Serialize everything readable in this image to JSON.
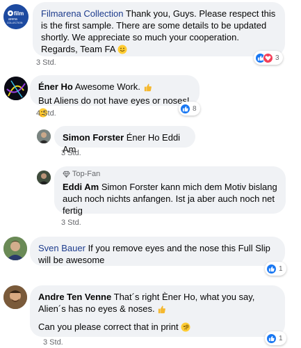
{
  "comments": [
    {
      "author": "Filmarena Collection",
      "text": "Thank you, Guys. Please respect this is the first sample. There are some details to be updated shortly. We appreciate so much your cooperation. Regards, Team FA",
      "time": "3 Std.",
      "reactions_count": "3"
    },
    {
      "author": "Éner Ho",
      "text_line1": "Awesome Work.",
      "text_line2": "But Aliens do not have eyes or noses!",
      "time": "4 Std.",
      "reactions_count": "8"
    },
    {
      "author": "Simon Forster",
      "text": "Éner Ho Eddi Am",
      "time": "3 Std."
    },
    {
      "badge": "Top-Fan",
      "author": "Eddi Am",
      "text": "Simon Forster kann mich dem Motiv bislang auch noch nichts anfangen. Ist ja aber auch noch net fertig",
      "time": "3 Std."
    },
    {
      "author": "Sven Bauer",
      "text": "If you remove eyes and the nose this Full Slip will be awesome",
      "reactions_count": "1"
    },
    {
      "author": "Andre Ten Venne",
      "text": "That´s right Èner Ho, what you say, Alien´s has no eyes & noses.",
      "text2": "Can you please correct that in print",
      "time": "3 Std.",
      "reactions_count": "1"
    }
  ],
  "avatars": {
    "filmarena_logo_text": "film arena COLLECTION"
  },
  "colors": {
    "bubble": "#f0f2f5",
    "like": "#1877f2",
    "love": "#f33e58",
    "secondary_text": "#65676b"
  }
}
